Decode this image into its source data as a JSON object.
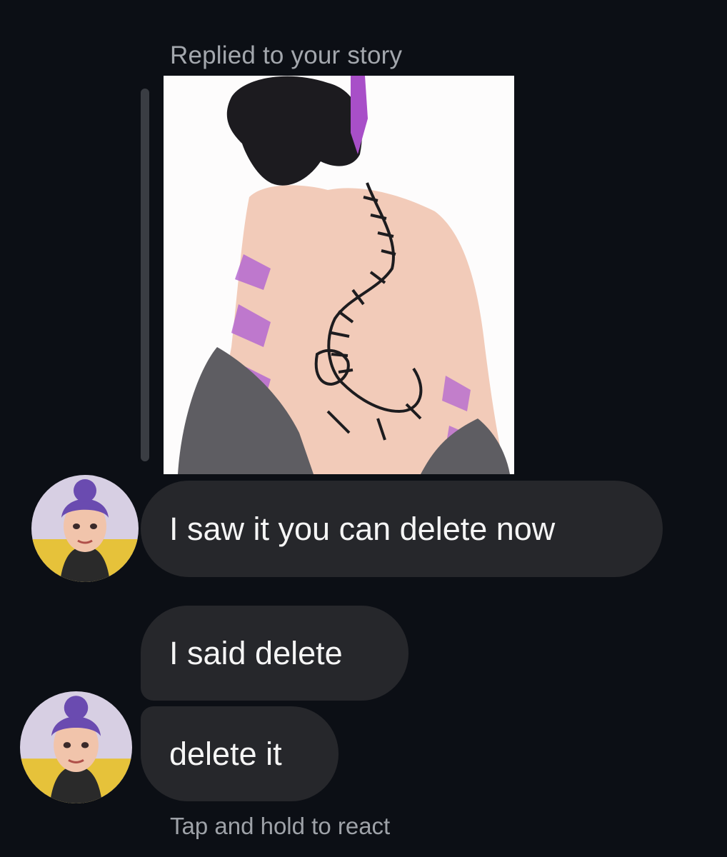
{
  "story": {
    "reply_label": "Replied to your story",
    "image_icon": "story-image-icon"
  },
  "messages": [
    {
      "text": "I saw it you can delete now"
    },
    {
      "text": "I said delete"
    },
    {
      "text": "delete it"
    }
  ],
  "avatar_icon": "avatar-icon",
  "hint": "Tap and hold to react",
  "colors": {
    "background": "#0c0f15",
    "bubble": "#26272b",
    "bubble_text": "#f5f5f5",
    "muted_text": "#a3a7ad"
  }
}
